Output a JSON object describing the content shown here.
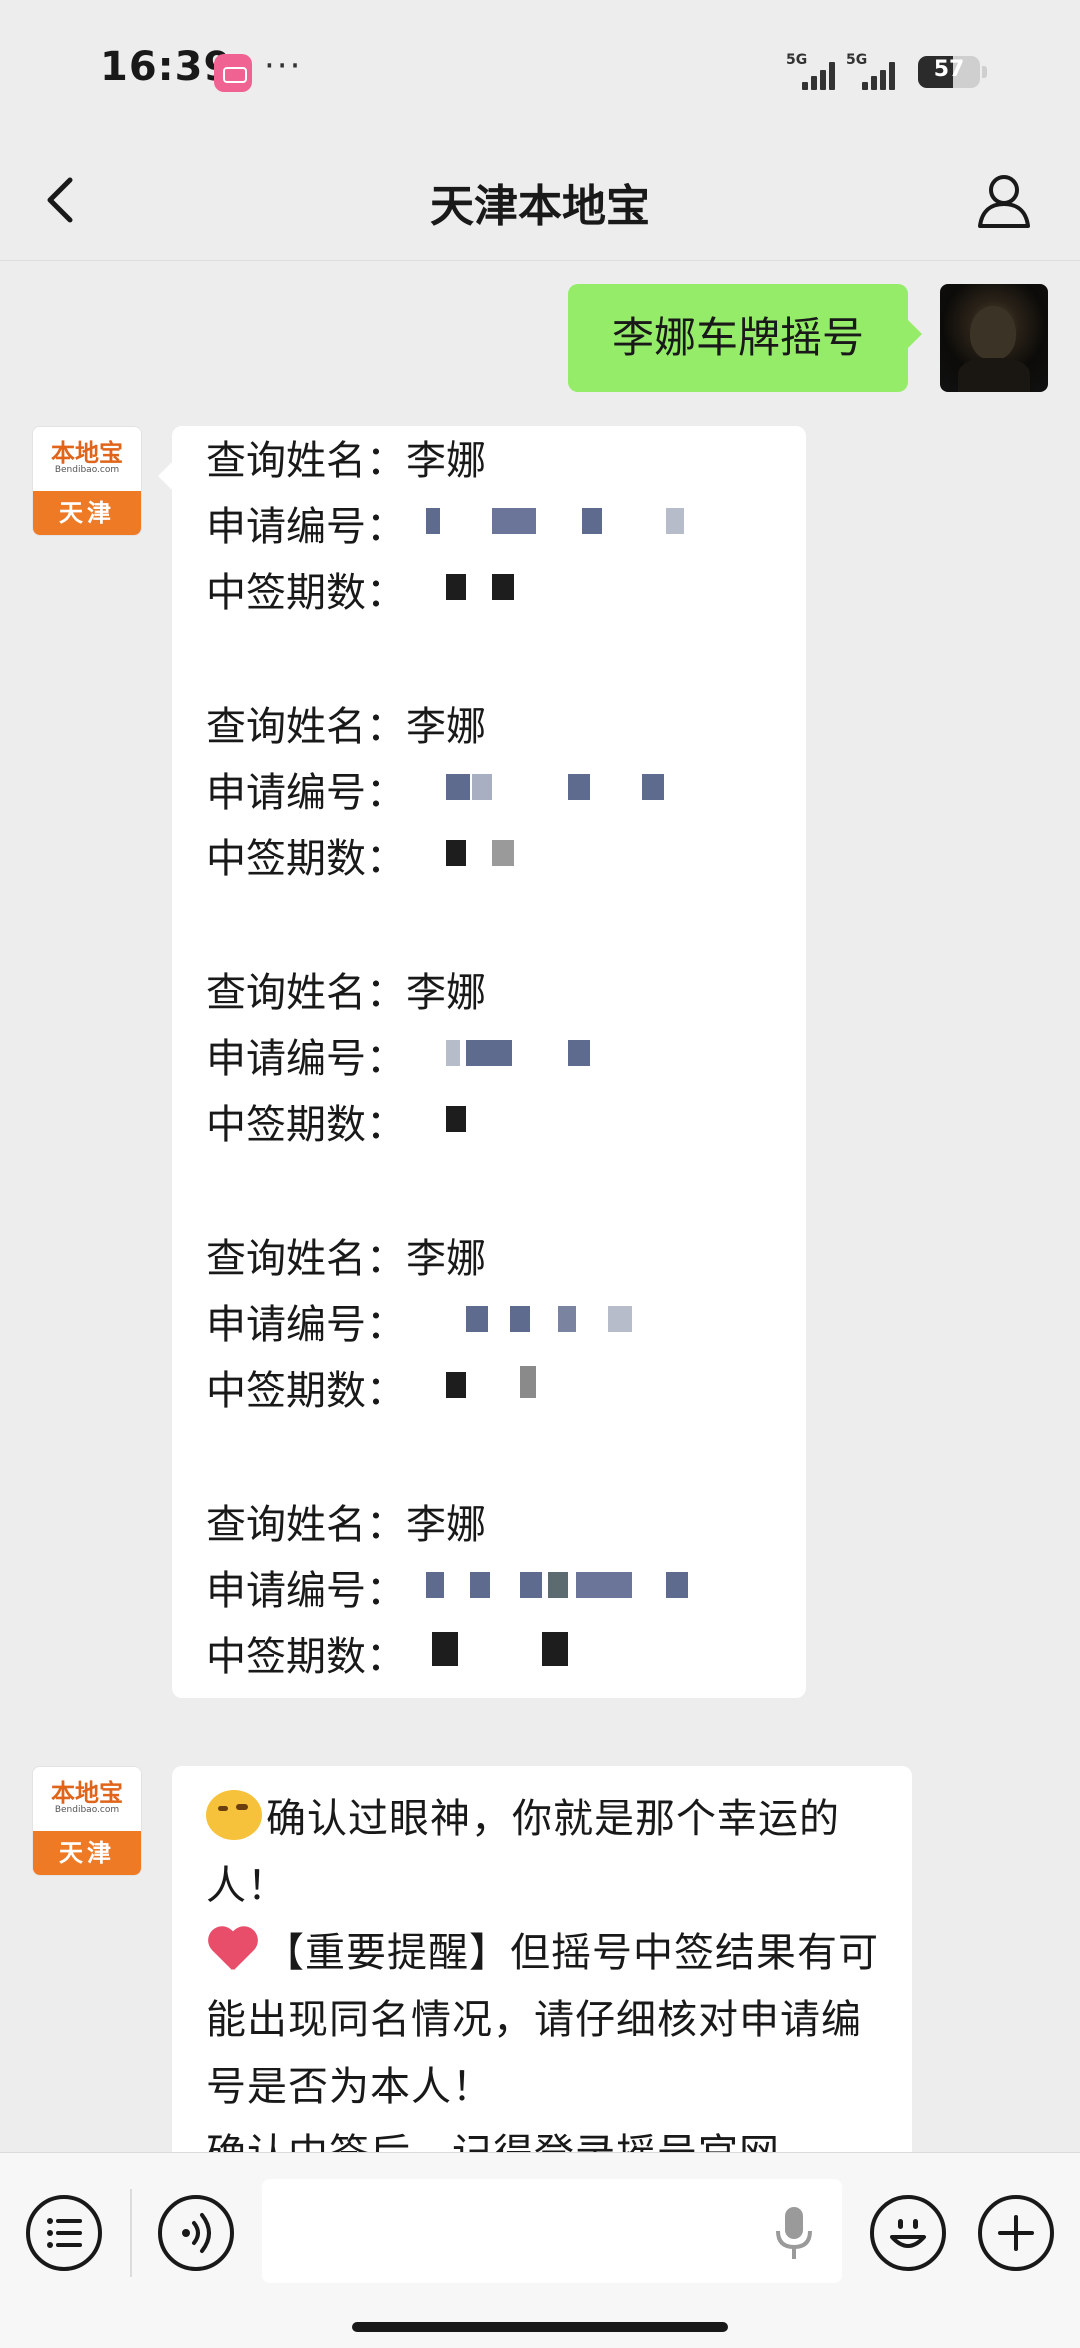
{
  "status_bar": {
    "time": "16:39",
    "network_1": "5G",
    "network_2": "5G",
    "battery": "57"
  },
  "header": {
    "title": "天津本地宝"
  },
  "messages": {
    "outgoing_text": "李娜车牌摇号",
    "bot_avatar_logo": "本地宝",
    "bot_avatar_site": "Bendibao.com",
    "bot_avatar_city": "天津",
    "results": [
      {
        "name_label": "查询姓名：",
        "name": "李娜",
        "app_label": "申请编号：",
        "period_label": "中签期数："
      },
      {
        "name_label": "查询姓名：",
        "name": "李娜",
        "app_label": "申请编号：",
        "period_label": "中签期数："
      },
      {
        "name_label": "查询姓名：",
        "name": "李娜",
        "app_label": "申请编号：",
        "period_label": "中签期数："
      },
      {
        "name_label": "查询姓名：",
        "name": "李娜",
        "app_label": "申请编号：",
        "period_label": "中签期数："
      },
      {
        "name_label": "查询姓名：",
        "name": "李娜",
        "app_label": "申请编号：",
        "period_label": "中签期数："
      }
    ],
    "notice_line1": "确认过眼神，你就是那个幸运的人！",
    "notice_line2": "【重要提醒】但摇号中签结果有可能出现同名情况，请仔细核对申请编号是否为本人！",
    "notice_line3": "确认中签后，记得登录摇号官网"
  },
  "colors": {
    "outgoing_bubble": "#95ec69",
    "incoming_bubble": "#ffffff",
    "background": "#ededed",
    "brand_orange": "#ef7a26"
  },
  "icons": {
    "back": "chevron-left-icon",
    "profile": "person-icon",
    "menu": "list-icon",
    "voice": "voice-icon",
    "mic": "microphone-icon",
    "emoji": "smiley-icon",
    "plus": "plus-icon"
  }
}
